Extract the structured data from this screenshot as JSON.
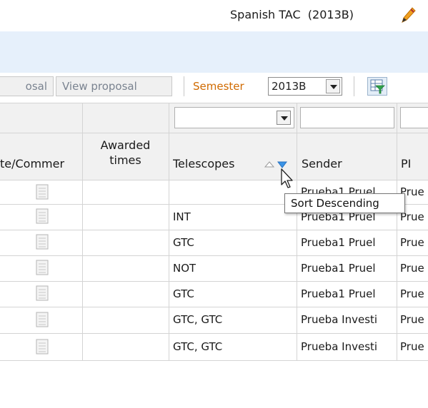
{
  "header": {
    "title": "Spanish TAC  (2013B)"
  },
  "toolbar": {
    "proposal_button": "osal",
    "view_proposal_button": "View proposal",
    "semester_label": "Semester",
    "semester_value": "2013B"
  },
  "table": {
    "columns": [
      {
        "label": "te/Commer"
      },
      {
        "label": "Awarded times"
      },
      {
        "label": "Telescopes"
      },
      {
        "label": "Sender"
      },
      {
        "label": "PI"
      }
    ],
    "rows": [
      {
        "telescopes": "",
        "sender": "Prueba1 Pruel",
        "pi": "Prue"
      },
      {
        "telescopes": "INT",
        "sender": "Prueba1 Pruel",
        "pi": "Prue"
      },
      {
        "telescopes": "GTC",
        "sender": "Prueba1 Pruel",
        "pi": "Prue"
      },
      {
        "telescopes": "NOT",
        "sender": "Prueba1 Pruel",
        "pi": "Prue"
      },
      {
        "telescopes": "GTC",
        "sender": "Prueba1 Pruel",
        "pi": "Prue"
      },
      {
        "telescopes": "GTC, GTC",
        "sender": "Prueba Investi",
        "pi": "Prue"
      },
      {
        "telescopes": "GTC, GTC",
        "sender": "Prueba Investi",
        "pi": "Prue"
      }
    ]
  },
  "tooltip": {
    "text": "Sort Descending"
  },
  "colors": {
    "accent_orange": "#d06a00",
    "header_band": "#e6f0fb",
    "sort_active": "#3a93e6"
  }
}
